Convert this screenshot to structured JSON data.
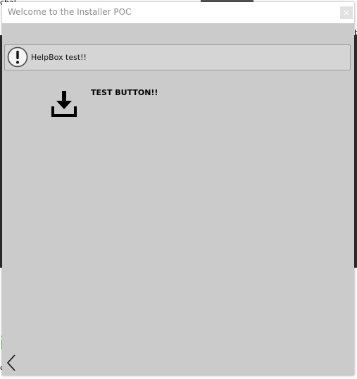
{
  "background_app": {
    "top_left_fragment": "chal",
    "right_fragment": "b",
    "bottom_left_fragment": "i",
    "bottom_left_small": "e"
  },
  "dialog": {
    "title": "Welcome to the Installer POC",
    "close_label": "×"
  },
  "helpbox": {
    "text": "HelpBox test!!",
    "icon": "exclamation-circle-icon"
  },
  "test_button": {
    "label": "TEST BUTTON!!",
    "icon": "download-icon"
  },
  "navigation": {
    "back_icon": "chevron-left-icon"
  },
  "colors": {
    "dialog_bg": "#cbcbcb",
    "titlebar_bg": "#ffffff",
    "title_text": "#8d8d8d",
    "helpbox_bg": "#d5d5d5"
  }
}
